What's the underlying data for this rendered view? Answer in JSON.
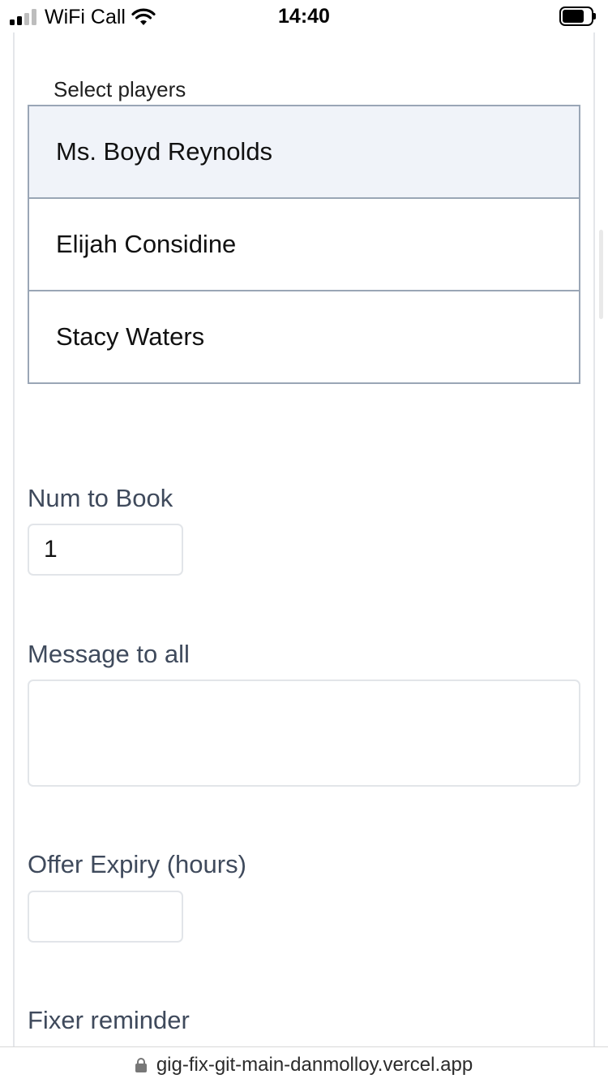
{
  "status_bar": {
    "carrier": "WiFi Call",
    "time": "14:40",
    "signal_bars_filled": 2,
    "signal_bars_total": 4
  },
  "players": {
    "legend": "Select players",
    "options": [
      {
        "name": "Ms. Boyd Reynolds",
        "selected": true
      },
      {
        "name": "Elijah Considine",
        "selected": false
      },
      {
        "name": "Stacy Waters",
        "selected": false
      }
    ]
  },
  "form": {
    "num_to_book_label": "Num to Book",
    "num_to_book_value": "1",
    "message_label": "Message to all",
    "message_value": "",
    "expiry_label": "Offer Expiry (hours)",
    "expiry_value": "",
    "fixer_reminder_label": "Fixer reminder"
  },
  "browser": {
    "url": "gig-fix-git-main-danmolloy.vercel.app"
  },
  "colors": {
    "selected_option_bg": "#f0f3f9",
    "option_border": "#9aa6b6",
    "label_text": "#3f4a5c"
  }
}
